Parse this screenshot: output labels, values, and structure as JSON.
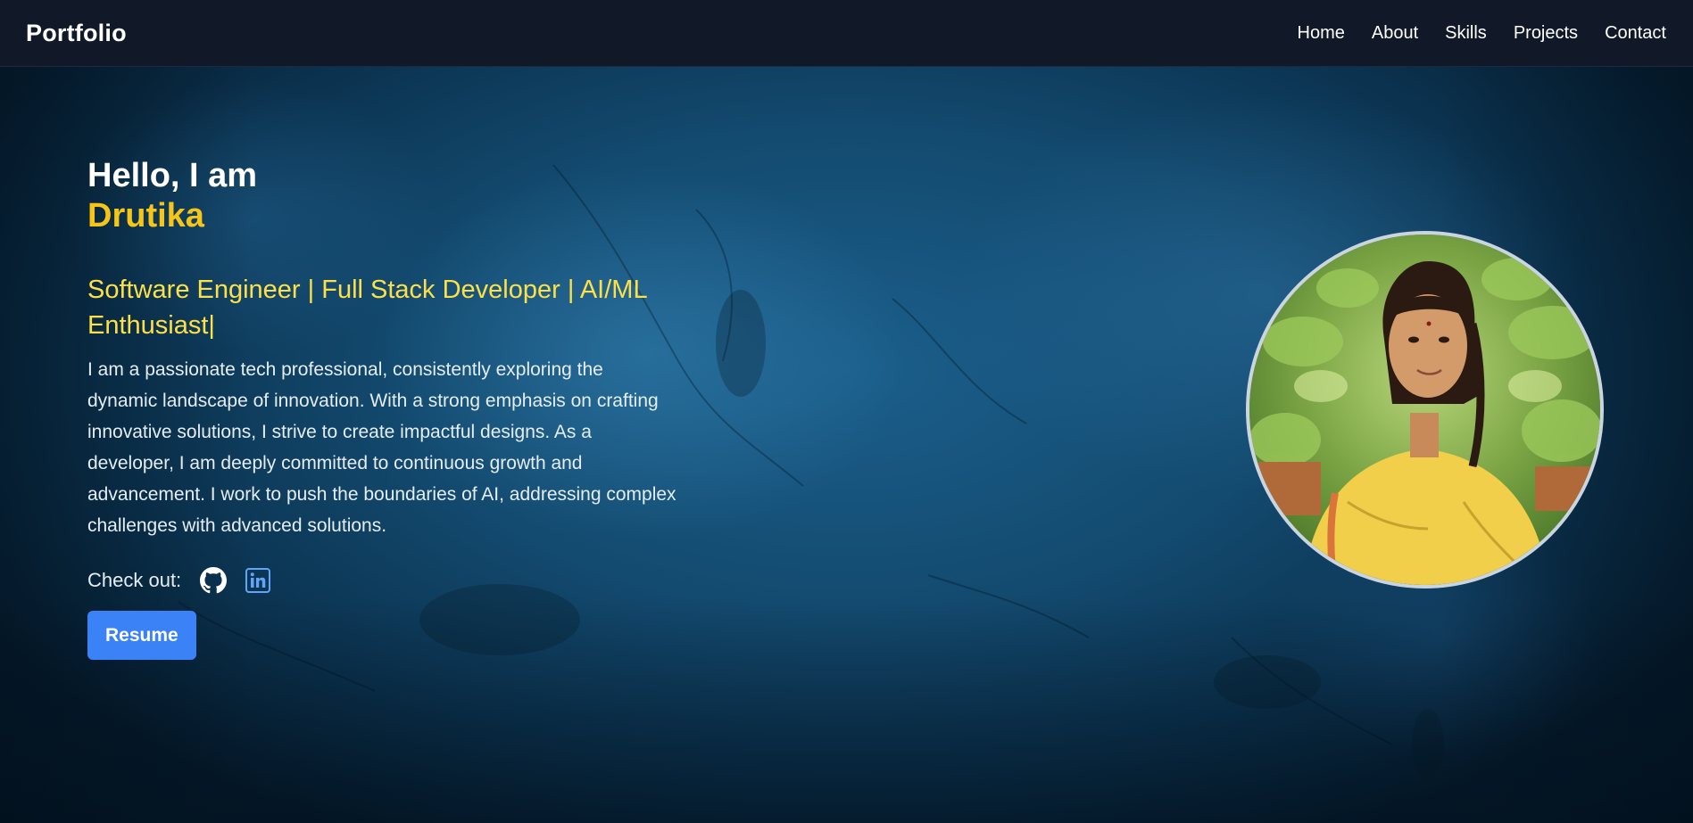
{
  "navbar": {
    "brand": "Portfolio",
    "links": [
      "Home",
      "About",
      "Skills",
      "Projects",
      "Contact"
    ]
  },
  "hero": {
    "greeting": "Hello, I am",
    "name": "Drutika",
    "role": "Software Engineer | Full Stack Developer | AI/ML Enthusiast",
    "cursor": "|",
    "bio": "I am a passionate tech professional, consistently exploring the dynamic landscape of innovation. With a strong emphasis on crafting innovative solutions, I strive to create impactful designs. As a developer, I am deeply committed to continuous growth and advancement. I work to push the boundaries of AI, addressing complex challenges with advanced solutions.",
    "checkout_label": "Check out:",
    "socials": [
      {
        "icon": "github-icon"
      },
      {
        "icon": "linkedin-icon"
      }
    ],
    "resume_label": "Resume"
  },
  "colors": {
    "navbar_bg": "#111827",
    "accent_name": "#f5c518",
    "accent_role": "#fde047",
    "button": "#3b82f6",
    "linkedin": "#60a5fa"
  }
}
